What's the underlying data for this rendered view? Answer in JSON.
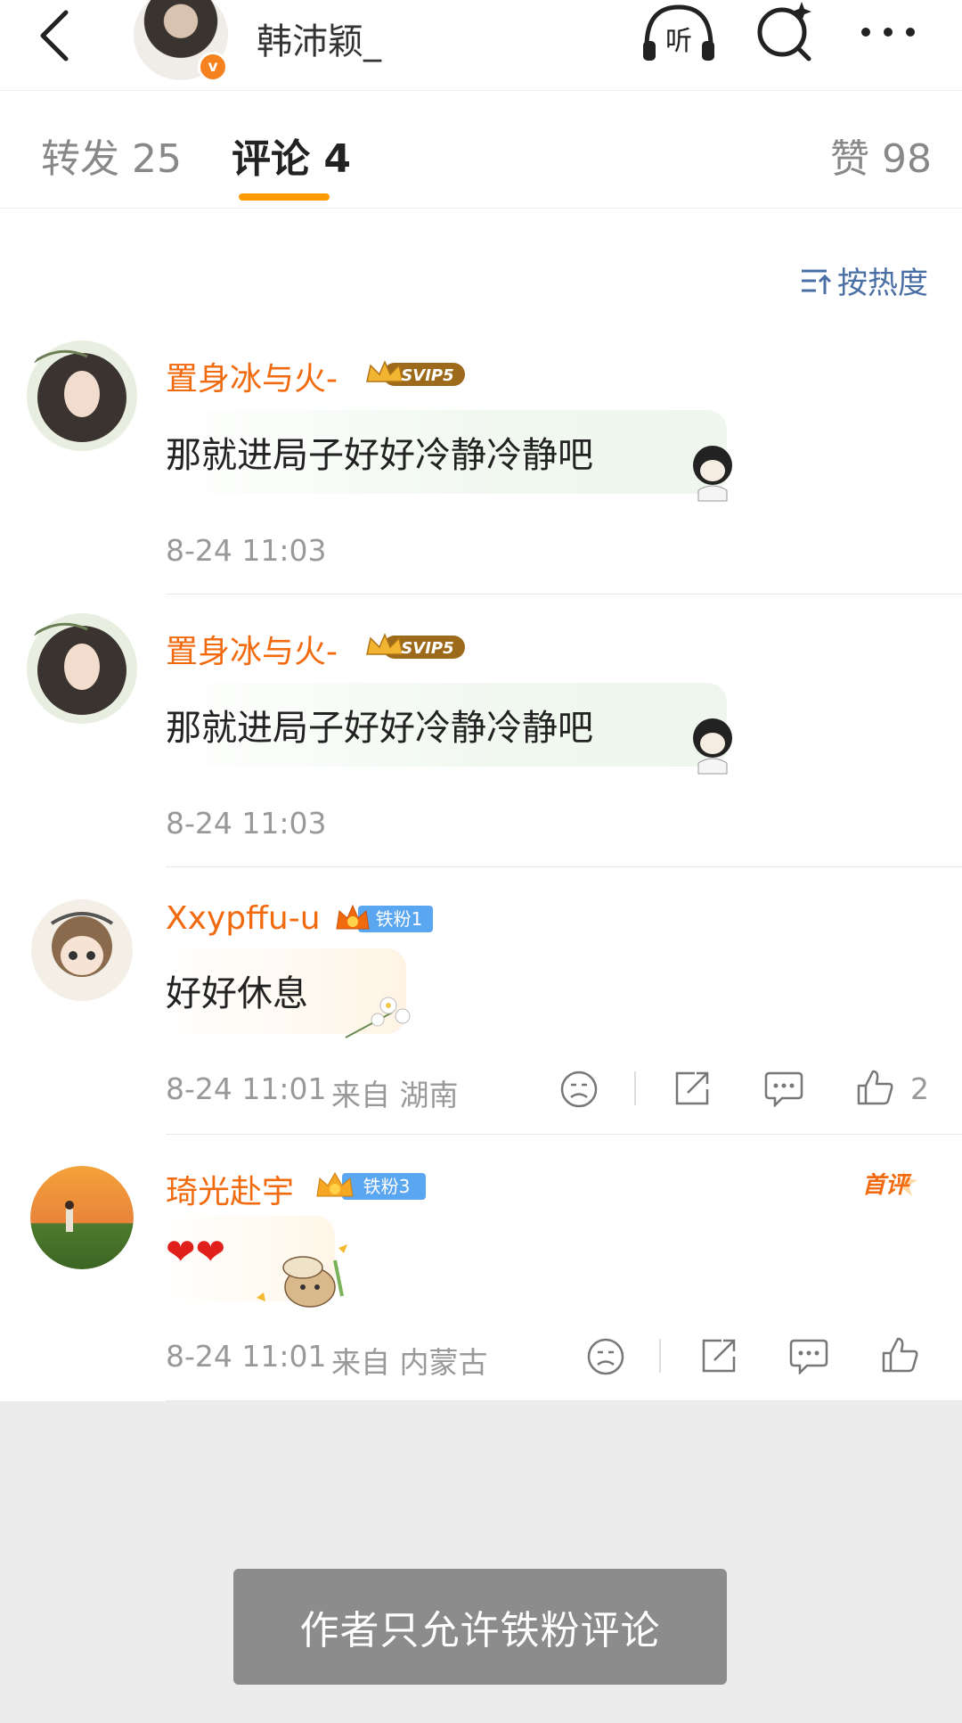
{
  "header": {
    "title": "韩沛颖_",
    "verified_mark": "v",
    "icons": [
      "back-icon",
      "listen-icon",
      "search-icon",
      "more-icon"
    ],
    "listen_label": "听"
  },
  "tabs": [
    {
      "label": "转发",
      "count": "25"
    },
    {
      "label": "评论",
      "count": "4",
      "active": true
    },
    {
      "label": "赞",
      "count": "98"
    }
  ],
  "sort": {
    "label": "按热度",
    "icon": "sort-icon"
  },
  "comments": [
    {
      "user": "置身冰与火-",
      "badge": "SVIP5",
      "text": "那就进局子好好冷静冷静吧",
      "time": "8-24 11:03",
      "location": "",
      "likes": ""
    },
    {
      "user": "置身冰与火-",
      "badge": "SVIP5",
      "text": "那就进局子好好冷静冷静吧",
      "time": "8-24 11:03",
      "location": "",
      "likes": ""
    },
    {
      "user": "Xxypffu-u",
      "badge": "铁粉1",
      "text": "好好休息",
      "time": "8-24 11:01",
      "location": "来自 湖南",
      "likes": "2"
    },
    {
      "user": "琦光赴宇",
      "badge": "铁粉3",
      "text": "❤❤",
      "time": "8-24 11:01",
      "location": "来自 内蒙古",
      "likes": "",
      "first_comment_label": "首评"
    }
  ],
  "notice": "作者只允许铁粉评论",
  "colors": {
    "username": "#f26a0e",
    "accent_underline": "#ff9a00",
    "sort_link": "#4a6fa5",
    "fan_badge": "#5aa6f0",
    "notice_bg": "#8c8c8c"
  }
}
